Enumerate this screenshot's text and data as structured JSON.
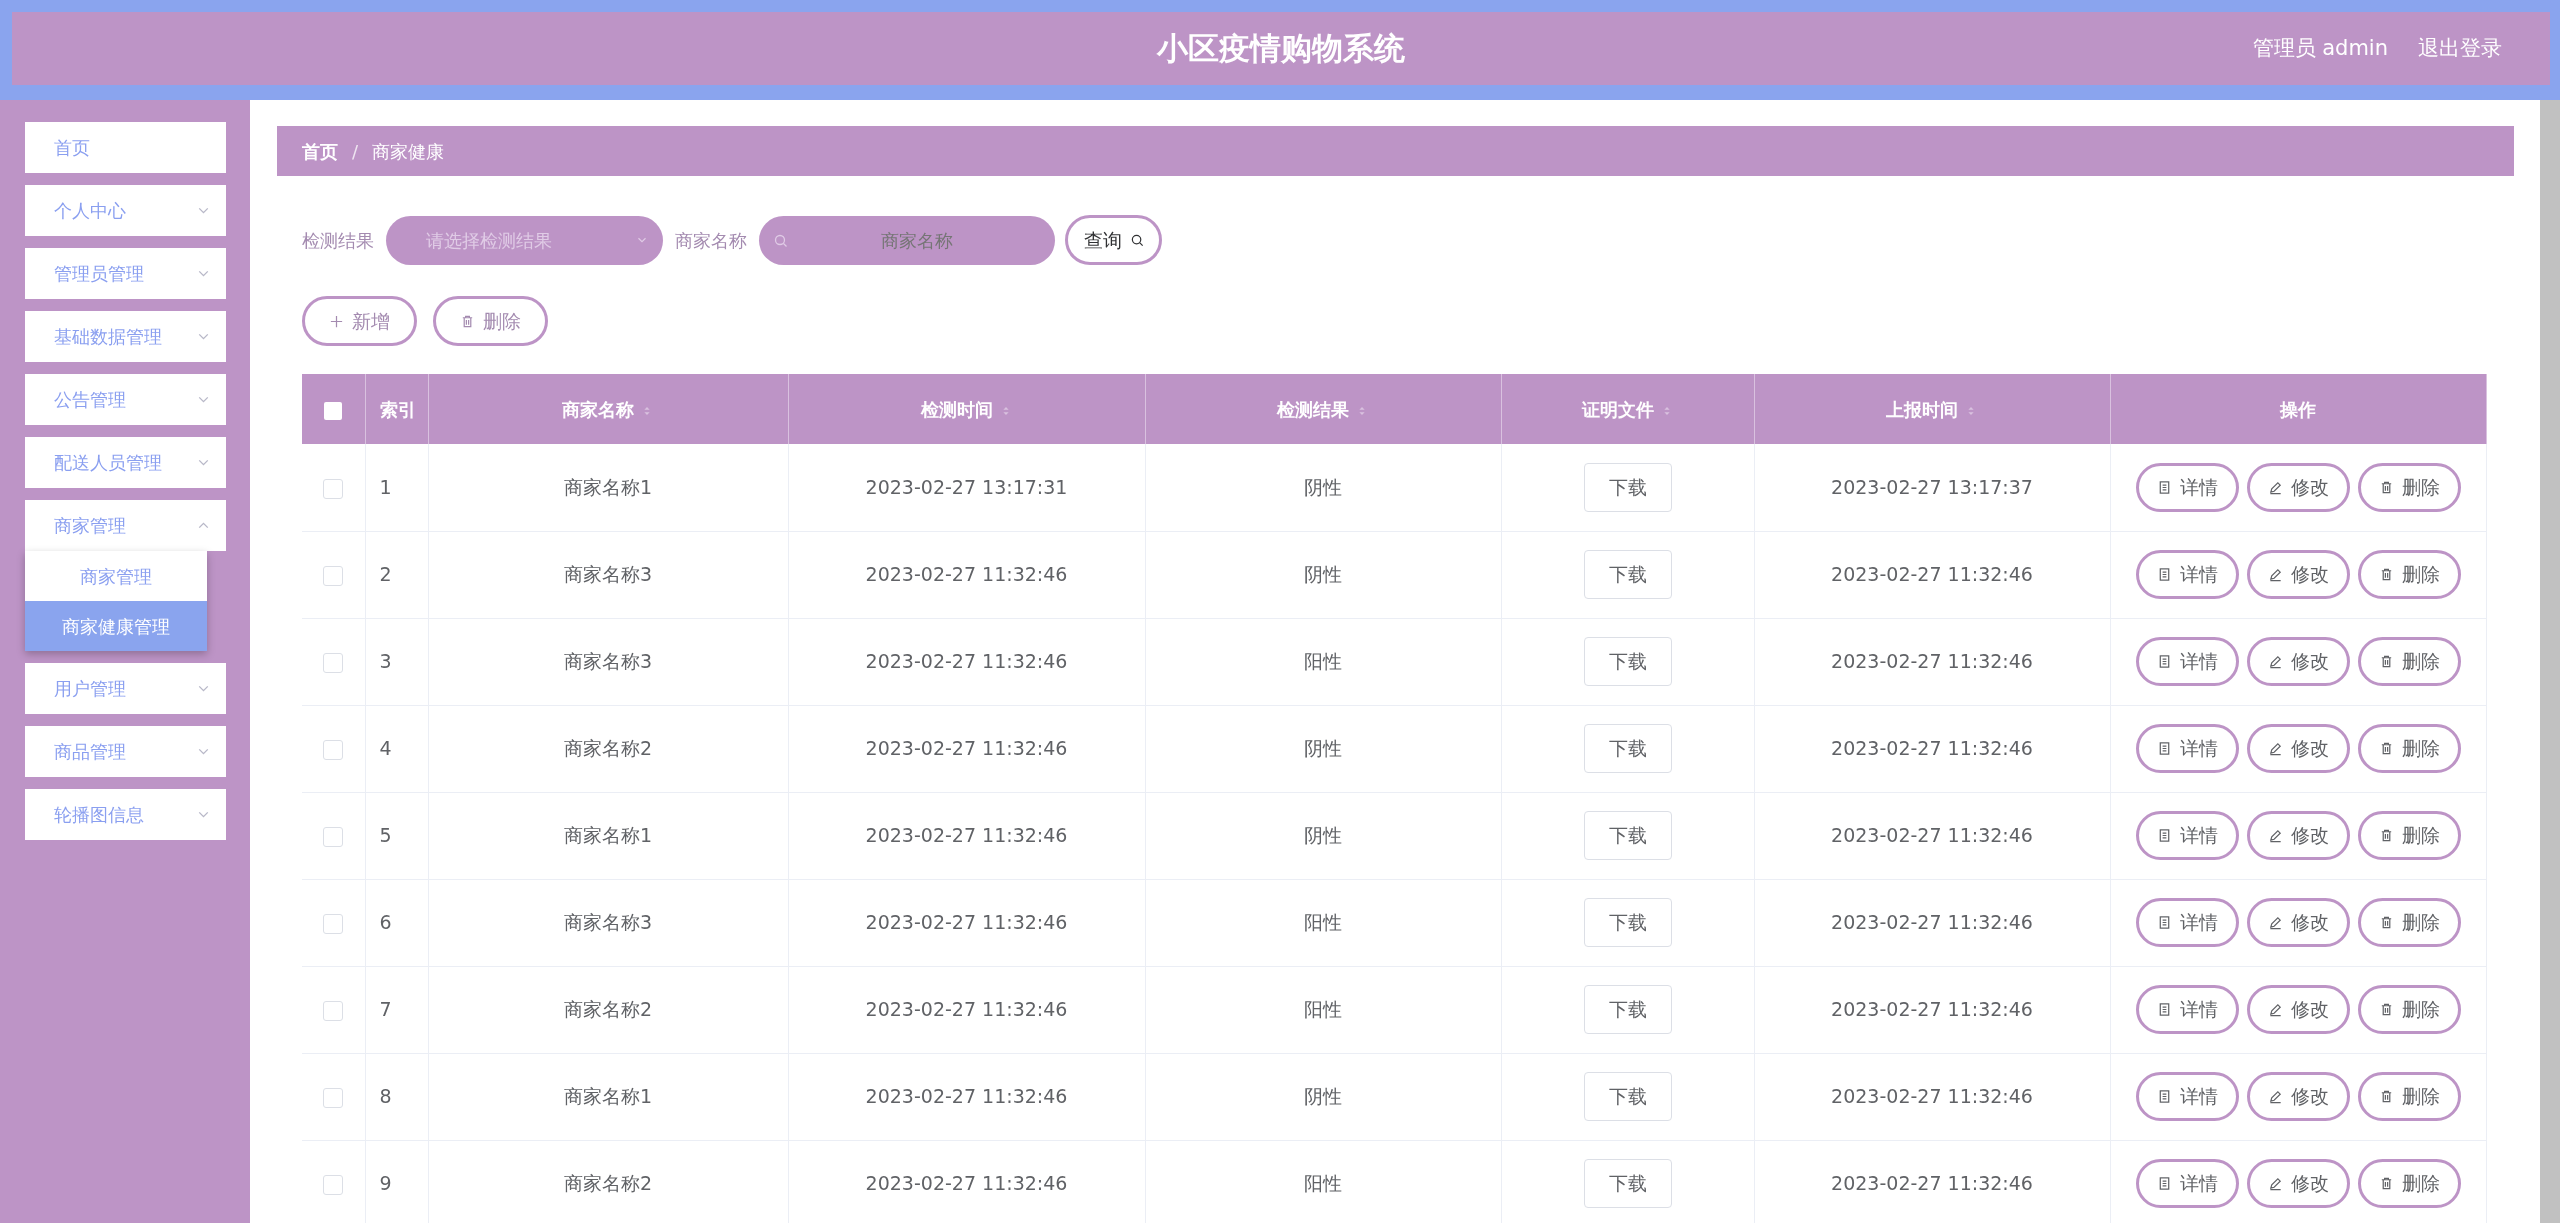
{
  "header": {
    "title": "小区疫情购物系统",
    "user": "管理员 admin",
    "logout": "退出登录"
  },
  "sidebar": {
    "items": [
      {
        "label": "首页",
        "kind": "link"
      },
      {
        "label": "个人中心",
        "kind": "menu",
        "expanded": false
      },
      {
        "label": "管理员管理",
        "kind": "menu",
        "expanded": false
      },
      {
        "label": "基础数据管理",
        "kind": "menu",
        "expanded": false
      },
      {
        "label": "公告管理",
        "kind": "menu",
        "expanded": false
      },
      {
        "label": "配送人员管理",
        "kind": "menu",
        "expanded": false
      },
      {
        "label": "商家管理",
        "kind": "menu",
        "expanded": true,
        "children": [
          {
            "label": "商家管理",
            "selected": false
          },
          {
            "label": "商家健康管理",
            "selected": true
          }
        ]
      },
      {
        "label": "用户管理",
        "kind": "menu",
        "expanded": false
      },
      {
        "label": "商品管理",
        "kind": "menu",
        "expanded": false
      },
      {
        "label": "轮播图信息",
        "kind": "menu",
        "expanded": false
      }
    ]
  },
  "breadcrumb": [
    "首页",
    "商家健康"
  ],
  "breadcrumb_separator": "/",
  "filters": {
    "result_label": "检测结果",
    "result_placeholder": "请选择检测结果",
    "name_label": "商家名称",
    "name_placeholder": "商家名称",
    "query": "查询"
  },
  "toolbar": [
    "新增",
    "删除"
  ],
  "table": {
    "header_checked": false,
    "columns": [
      {
        "label": "索引",
        "sortable": false
      },
      {
        "label": "商家名称",
        "sortable": true
      },
      {
        "label": "检测时间",
        "sortable": true
      },
      {
        "label": "检测结果",
        "sortable": true
      },
      {
        "label": "证明文件",
        "sortable": true
      },
      {
        "label": "上报时间",
        "sortable": true
      },
      {
        "label": "操作",
        "sortable": false
      }
    ],
    "rows": [
      {
        "checked": false,
        "index": "1",
        "name": "商家名称1",
        "time": "2023-02-27 13:17:31",
        "result": "阴性",
        "file": "下载",
        "reported": "2023-02-27 13:17:37",
        "actions": [
          "详情",
          "修改",
          "删除"
        ]
      },
      {
        "checked": false,
        "index": "2",
        "name": "商家名称3",
        "time": "2023-02-27 11:32:46",
        "result": "阴性",
        "file": "下载",
        "reported": "2023-02-27 11:32:46",
        "actions": [
          "详情",
          "修改",
          "删除"
        ]
      },
      {
        "checked": false,
        "index": "3",
        "name": "商家名称3",
        "time": "2023-02-27 11:32:46",
        "result": "阳性",
        "file": "下载",
        "reported": "2023-02-27 11:32:46",
        "actions": [
          "详情",
          "修改",
          "删除"
        ]
      },
      {
        "checked": false,
        "index": "4",
        "name": "商家名称2",
        "time": "2023-02-27 11:32:46",
        "result": "阴性",
        "file": "下载",
        "reported": "2023-02-27 11:32:46",
        "actions": [
          "详情",
          "修改",
          "删除"
        ]
      },
      {
        "checked": false,
        "index": "5",
        "name": "商家名称1",
        "time": "2023-02-27 11:32:46",
        "result": "阴性",
        "file": "下载",
        "reported": "2023-02-27 11:32:46",
        "actions": [
          "详情",
          "修改",
          "删除"
        ]
      },
      {
        "checked": false,
        "index": "6",
        "name": "商家名称3",
        "time": "2023-02-27 11:32:46",
        "result": "阳性",
        "file": "下载",
        "reported": "2023-02-27 11:32:46",
        "actions": [
          "详情",
          "修改",
          "删除"
        ]
      },
      {
        "checked": false,
        "index": "7",
        "name": "商家名称2",
        "time": "2023-02-27 11:32:46",
        "result": "阳性",
        "file": "下载",
        "reported": "2023-02-27 11:32:46",
        "actions": [
          "详情",
          "修改",
          "删除"
        ]
      },
      {
        "checked": false,
        "index": "8",
        "name": "商家名称1",
        "time": "2023-02-27 11:32:46",
        "result": "阴性",
        "file": "下载",
        "reported": "2023-02-27 11:32:46",
        "actions": [
          "详情",
          "修改",
          "删除"
        ]
      },
      {
        "checked": false,
        "index": "9",
        "name": "商家名称2",
        "time": "2023-02-27 11:32:46",
        "result": "阳性",
        "file": "下载",
        "reported": "2023-02-27 11:32:46",
        "actions": [
          "详情",
          "修改",
          "删除"
        ]
      }
    ]
  }
}
